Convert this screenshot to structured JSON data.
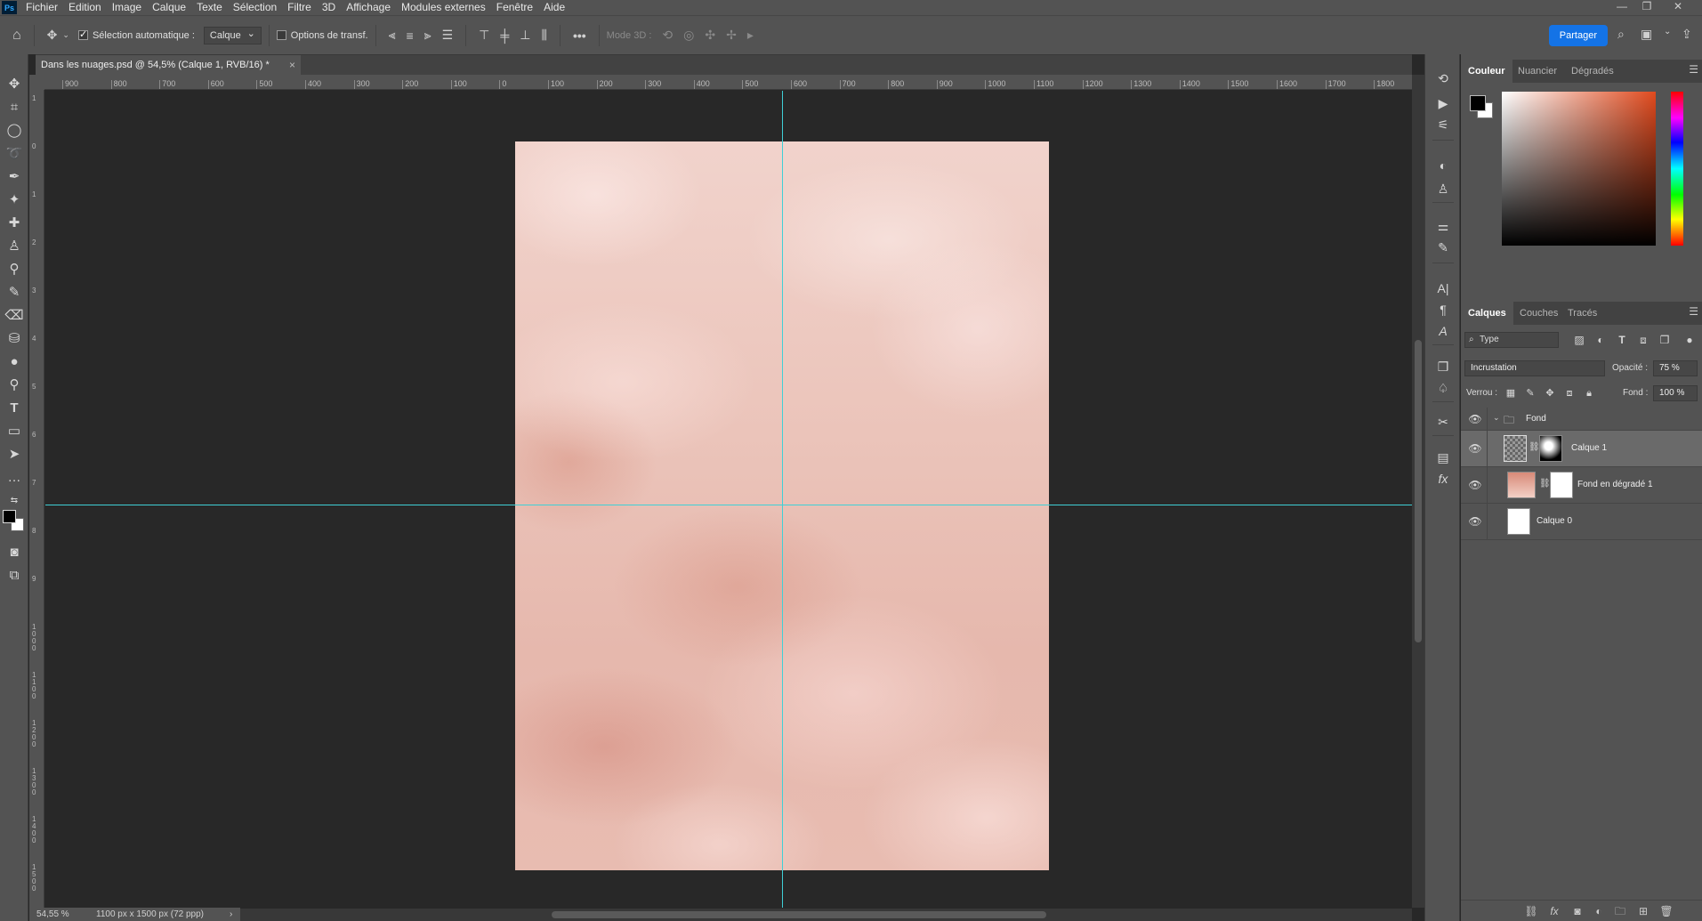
{
  "app": {
    "logo": "Ps"
  },
  "menu": [
    "Fichier",
    "Edition",
    "Image",
    "Calque",
    "Texte",
    "Sélection",
    "Filtre",
    "3D",
    "Affichage",
    "Modules externes",
    "Fenêtre",
    "Aide"
  ],
  "window_controls": {
    "minimize": "—",
    "restore": "❐",
    "close": "✕"
  },
  "options_bar": {
    "auto_select_label": "Sélection automatique :",
    "auto_select_checked": true,
    "auto_select_target": "Calque",
    "transform_options_label": "Options de transf.",
    "transform_options_checked": false,
    "more_label": "•••",
    "mode3d_label": "Mode 3D :",
    "share_label": "Partager"
  },
  "document_tab": {
    "title": "Dans les nuages.psd @ 54,5% (Calque 1, RVB/16) *",
    "close": "×"
  },
  "ruler_top": [
    "900",
    "800",
    "700",
    "600",
    "500",
    "400",
    "300",
    "200",
    "100",
    "0",
    "100",
    "200",
    "300",
    "400",
    "500",
    "600",
    "700",
    "800",
    "900",
    "1000",
    "1100",
    "1200",
    "1300",
    "1400",
    "1500",
    "1600",
    "1700",
    "1800"
  ],
  "ruler_left": [
    "1",
    "0",
    "1",
    "2",
    "3",
    "4",
    "5",
    "6",
    "7",
    "8",
    "9",
    "1000",
    "1100",
    "1200",
    "1300",
    "1400",
    "1500",
    "1600"
  ],
  "status": {
    "zoom": "54,55 %",
    "dimensions": "1100 px x 1500 px (72 ppp)",
    "arrow": "›"
  },
  "color_panel": {
    "tabs": [
      "Couleur",
      "Nuancier",
      "Dégradés"
    ],
    "active": "Couleur",
    "fg": "#000000",
    "bg": "#ffffff"
  },
  "layers_panel": {
    "tabs": [
      "Calques",
      "Couches",
      "Tracés"
    ],
    "active": "Calques",
    "filter_label": "Type",
    "blend_mode": "Incrustation",
    "opacity_label": "Opacité :",
    "opacity_value": "75 %",
    "lock_label": "Verrou :",
    "fill_label": "Fond :",
    "fill_value": "100 %",
    "layers": [
      {
        "name": "Fond",
        "type": "group"
      },
      {
        "name": "Calque 1",
        "type": "layer",
        "selected": true
      },
      {
        "name": "Fond en dégradé 1",
        "type": "gradient-fill"
      },
      {
        "name": "Calque 0",
        "type": "layer"
      }
    ]
  },
  "colors": {
    "accent": "#1473e6",
    "guide": "#3fd0d6",
    "ui_bg": "#535353",
    "canvas_bg": "#282828"
  }
}
